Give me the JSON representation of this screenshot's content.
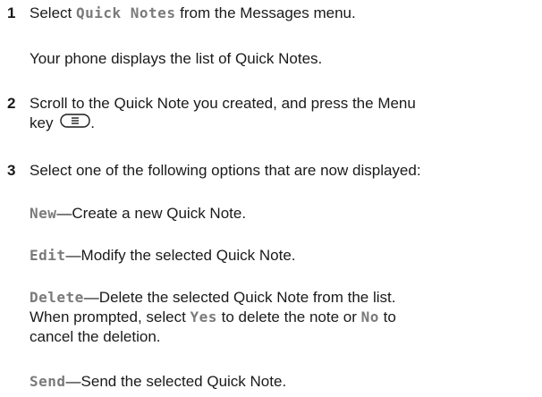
{
  "steps": [
    {
      "number": "1",
      "pre": "Select ",
      "term": "Quick Notes",
      "post": " from the Messages menu.",
      "note": "Your phone displays the list of Quick Notes."
    },
    {
      "number": "2",
      "line1": "Scroll to the Quick Note you created, and press the Menu",
      "line2": "key",
      "line2_end": ".",
      "key_icon": "menu-key-icon"
    },
    {
      "number": "3",
      "text": "Select one of the following options that are now displayed:"
    }
  ],
  "options": {
    "new": {
      "term": "New",
      "desc": "—Create a new Quick Note."
    },
    "edit": {
      "term": "Edit",
      "desc": "—Modify the selected Quick Note."
    },
    "delete": {
      "term": "Delete",
      "desc": "—Delete the selected Quick Note from the list.",
      "line2_pre": "When prompted, select ",
      "yes_term": "Yes",
      "line2_mid": " to delete the note or ",
      "no_term": "No",
      "line2_post": " to",
      "line3": "cancel the deletion."
    },
    "send": {
      "term": "Send",
      "desc": "—Send the selected Quick Note."
    }
  }
}
